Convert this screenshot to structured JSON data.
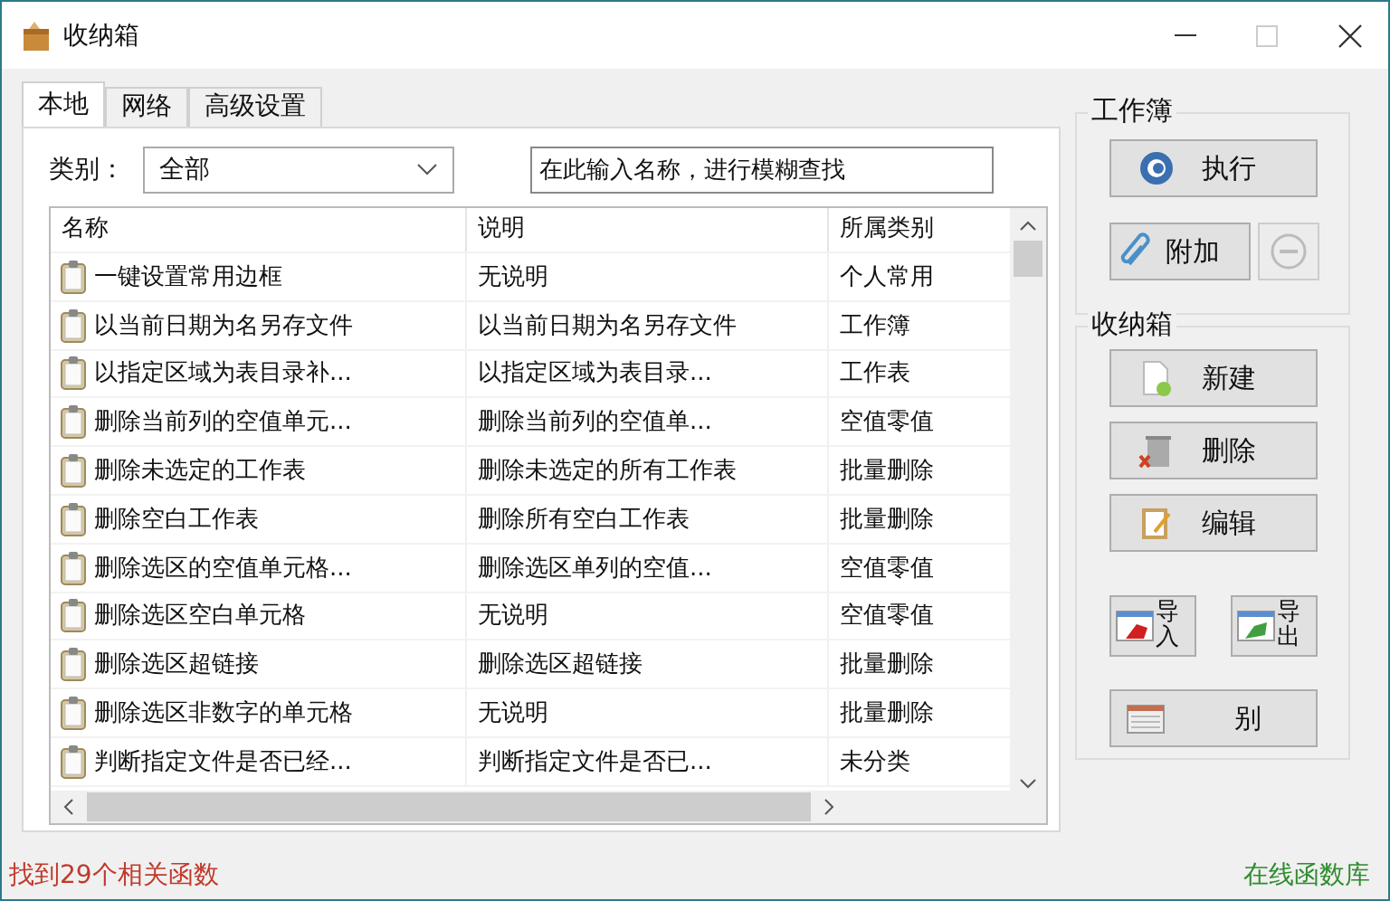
{
  "window": {
    "title": "收纳箱"
  },
  "tabs": [
    {
      "label": "本地",
      "selected": true
    },
    {
      "label": "网络",
      "selected": false
    },
    {
      "label": "高级设置",
      "selected": false
    }
  ],
  "filter": {
    "label": "类别：",
    "value": "全部"
  },
  "search": {
    "placeholder": "在此输入名称，进行模糊查找"
  },
  "table": {
    "columns": [
      "名称",
      "说明",
      "所属类别"
    ],
    "rows": [
      {
        "name": "一键设置常用边框",
        "description": "无说明",
        "category": "个人常用"
      },
      {
        "name": "以当前日期为名另存文件",
        "description": "以当前日期为名另存文件",
        "category": "工作簿"
      },
      {
        "name": "以指定区域为表目录补...",
        "description": "以指定区域为表目录...",
        "category": "工作表"
      },
      {
        "name": "删除当前列的空值单元...",
        "description": "删除当前列的空值单...",
        "category": "空值零值"
      },
      {
        "name": "删除未选定的工作表",
        "description": "删除未选定的所有工作表",
        "category": "批量删除"
      },
      {
        "name": "删除空白工作表",
        "description": "删除所有空白工作表",
        "category": "批量删除"
      },
      {
        "name": "删除选区的空值单元格...",
        "description": "删除选区单列的空值...",
        "category": "空值零值"
      },
      {
        "name": "删除选区空白单元格",
        "description": "无说明",
        "category": "空值零值"
      },
      {
        "name": "删除选区超链接",
        "description": "删除选区超链接",
        "category": "批量删除"
      },
      {
        "name": "删除选区非数字的单元格",
        "description": "无说明",
        "category": "批量删除"
      },
      {
        "name": "判断指定文件是否已经...",
        "description": "判断指定文件是否已...",
        "category": "未分类"
      }
    ]
  },
  "workbook_group": {
    "title": "工作簿",
    "buttons": [
      {
        "kind": "run",
        "label": "执行",
        "disabled": false
      },
      {
        "kind": "attach",
        "label": "附加",
        "disabled": false
      },
      {
        "kind": "remove",
        "disabled": true
      }
    ]
  },
  "box_group": {
    "title": "收纳箱",
    "buttons": [
      {
        "kind": "new",
        "label": "新建"
      },
      {
        "kind": "delete",
        "label": "删除"
      },
      {
        "kind": "edit",
        "label": "编辑"
      },
      {
        "kind": "import",
        "label": "导入"
      },
      {
        "kind": "export",
        "label": "导出"
      },
      {
        "kind": "category",
        "label": "别"
      }
    ]
  },
  "status_bar": {
    "result": "找到29个相关函数",
    "link": "在线函数库"
  }
}
